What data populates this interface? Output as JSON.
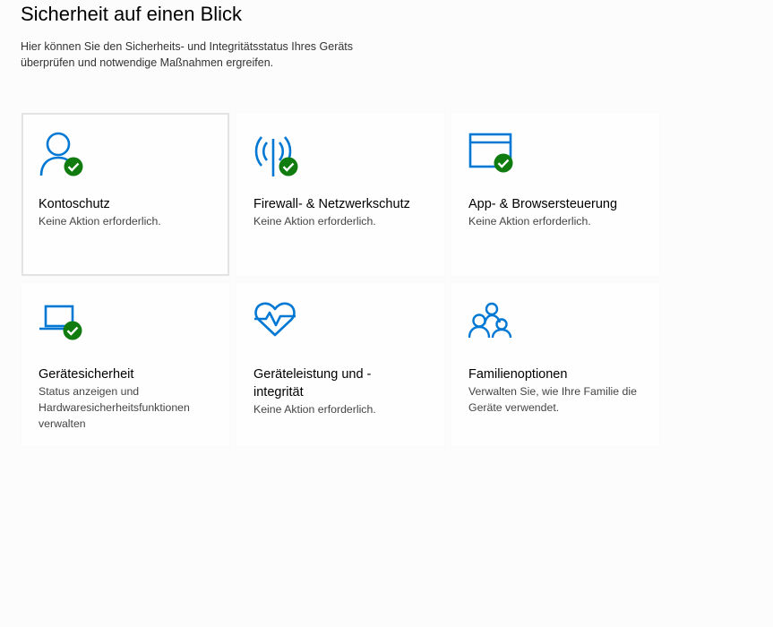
{
  "header": {
    "title": "Sicherheit auf einen Blick",
    "subtitle": "Hier können Sie den Sicherheits- und Integritätsstatus Ihres Geräts überprüfen und notwendige Maßnahmen ergreifen."
  },
  "colors": {
    "icon_blue": "#0078d4",
    "status_green": "#107c10",
    "focus_border": "#e3e3e3"
  },
  "tiles": [
    {
      "icon": "account-protection-icon",
      "title": "Kontoschutz",
      "description": "Keine Aktion erforderlich.",
      "status": "ok"
    },
    {
      "icon": "firewall-network-icon",
      "title": "Firewall- & Netzwerkschutz",
      "description": "Keine Aktion erforderlich.",
      "status": "ok"
    },
    {
      "icon": "app-browser-control-icon",
      "title": "App- & Browsersteuerung",
      "description": "Keine Aktion erforderlich.",
      "status": "ok"
    },
    {
      "icon": "device-security-icon",
      "title": "Gerätesicherheit",
      "description": "Status anzeigen und Hardwaresicherheitsfunktionen verwalten",
      "status": "ok"
    },
    {
      "icon": "device-performance-health-icon",
      "title": "Geräteleistung und -integrität",
      "description": "Keine Aktion erforderlich.",
      "status": "none"
    },
    {
      "icon": "family-options-icon",
      "title": "Familienoptionen",
      "description": "Verwalten Sie, wie Ihre Familie die Geräte verwendet.",
      "status": "none"
    }
  ]
}
